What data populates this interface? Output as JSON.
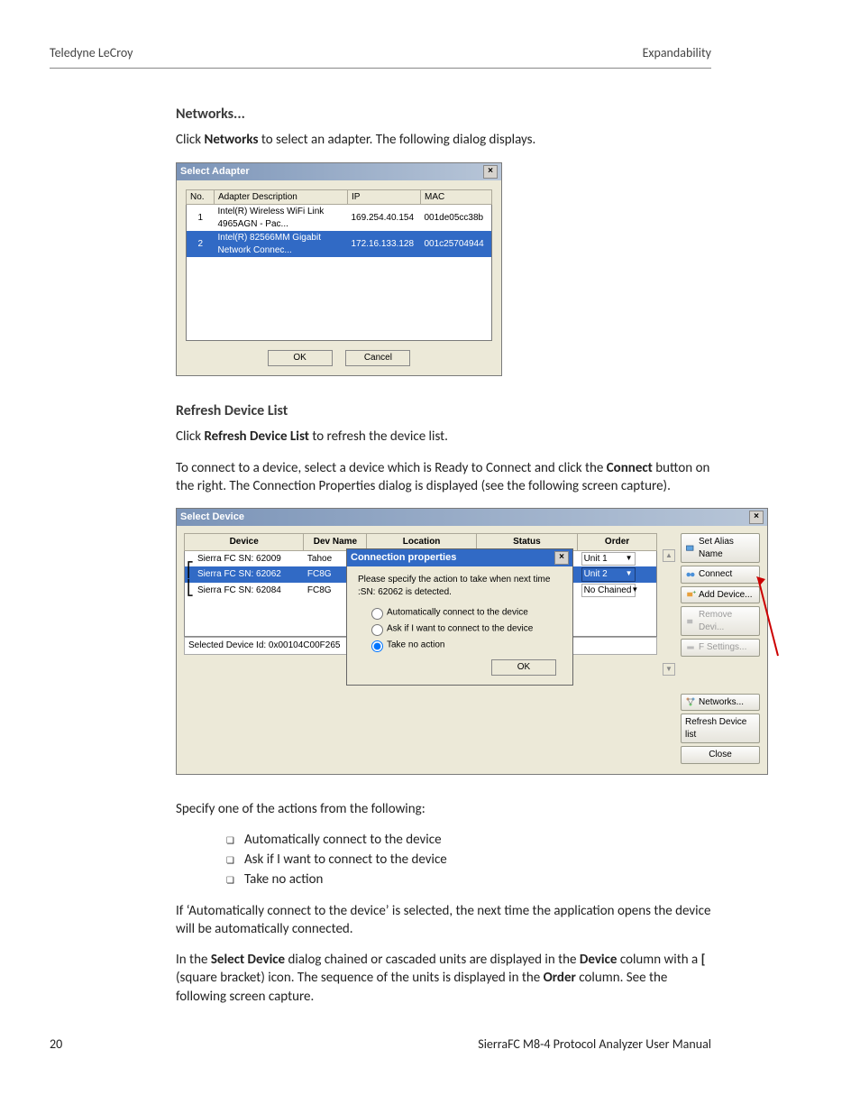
{
  "header": {
    "left": "Teledyne LeCroy",
    "right": "Expandability"
  },
  "section1": {
    "heading": "Networks...",
    "para": "Click <b>Networks</b> to select an adapter. The following dialog displays."
  },
  "adapterDialog": {
    "title": "Select Adapter",
    "cols": {
      "no": "No.",
      "desc": "Adapter Description",
      "ip": "IP",
      "mac": "MAC"
    },
    "rows": [
      {
        "no": "1",
        "desc": "Intel(R) Wireless WiFi Link 4965AGN - Pac...",
        "ip": "169.254.40.154",
        "mac": "001de05cc38b"
      },
      {
        "no": "2",
        "desc": "Intel(R) 82566MM Gigabit Network Connec...",
        "ip": "172.16.133.128",
        "mac": "001c25704944"
      }
    ],
    "ok": "OK",
    "cancel": "Cancel"
  },
  "section2": {
    "heading": "Refresh Device List",
    "p1": "Click <b>Refresh Device List</b> to refresh the device list.",
    "p2": "To connect to a device, select a device which is Ready to Connect and click the <b>Connect</b> button on the right. The Connection Properties dialog is displayed (see the following screen capture)."
  },
  "selectDevice": {
    "title": "Select Device",
    "cols": {
      "device": "Device",
      "devname": "Dev Name",
      "location": "Location",
      "status": "Status",
      "order": "Order"
    },
    "rows": [
      {
        "device": "Sierra FC SN: 62009",
        "devname": "Tahoe",
        "order": "Unit 1"
      },
      {
        "device": "Sierra FC SN: 62062",
        "devname": "FC8G",
        "order": "Unit 2",
        "sel": true
      },
      {
        "device": "Sierra FC SN: 62084",
        "devname": "FC8G",
        "order": "No Chained"
      }
    ],
    "selectedId": "Selected Device Id: 0x00104C00F265",
    "buttons": {
      "setAlias": "Set Alias Name",
      "connect": "Connect",
      "addDevice": "Add Device...",
      "removeDevi": "Remove Devi...",
      "fsettings": "F Settings...",
      "networks": "Networks...",
      "refresh": "Refresh Device list",
      "close": "Close"
    }
  },
  "connProps": {
    "title": "Connection properties",
    "msg": "Please specify the action to take when next time :SN: 62062 is detected.",
    "r1": "Automatically connect to the device",
    "r2": "Ask if I want to connect to the device",
    "r3": "Take no action",
    "ok": "OK"
  },
  "after": {
    "p1": "Specify one of the actions from the following:",
    "b1": "Automatically connect to the device",
    "b2": "Ask if I want to connect to the device",
    "b3": "Take no action",
    "p2": "If ‘Automatically connect to the device’ is selected, the next time the application opens the device will be automatically connected.",
    "p3": "In the <b>Select Device</b> dialog chained or cascaded units are displayed in the <b>Device</b> column with a <b>[</b> (square bracket) icon. The sequence of the units is displayed in the <b>Order</b> column. See the following screen capture."
  },
  "footer": {
    "left": "20",
    "right": "SierraFC M8-4 Protocol Analyzer User Manual"
  }
}
